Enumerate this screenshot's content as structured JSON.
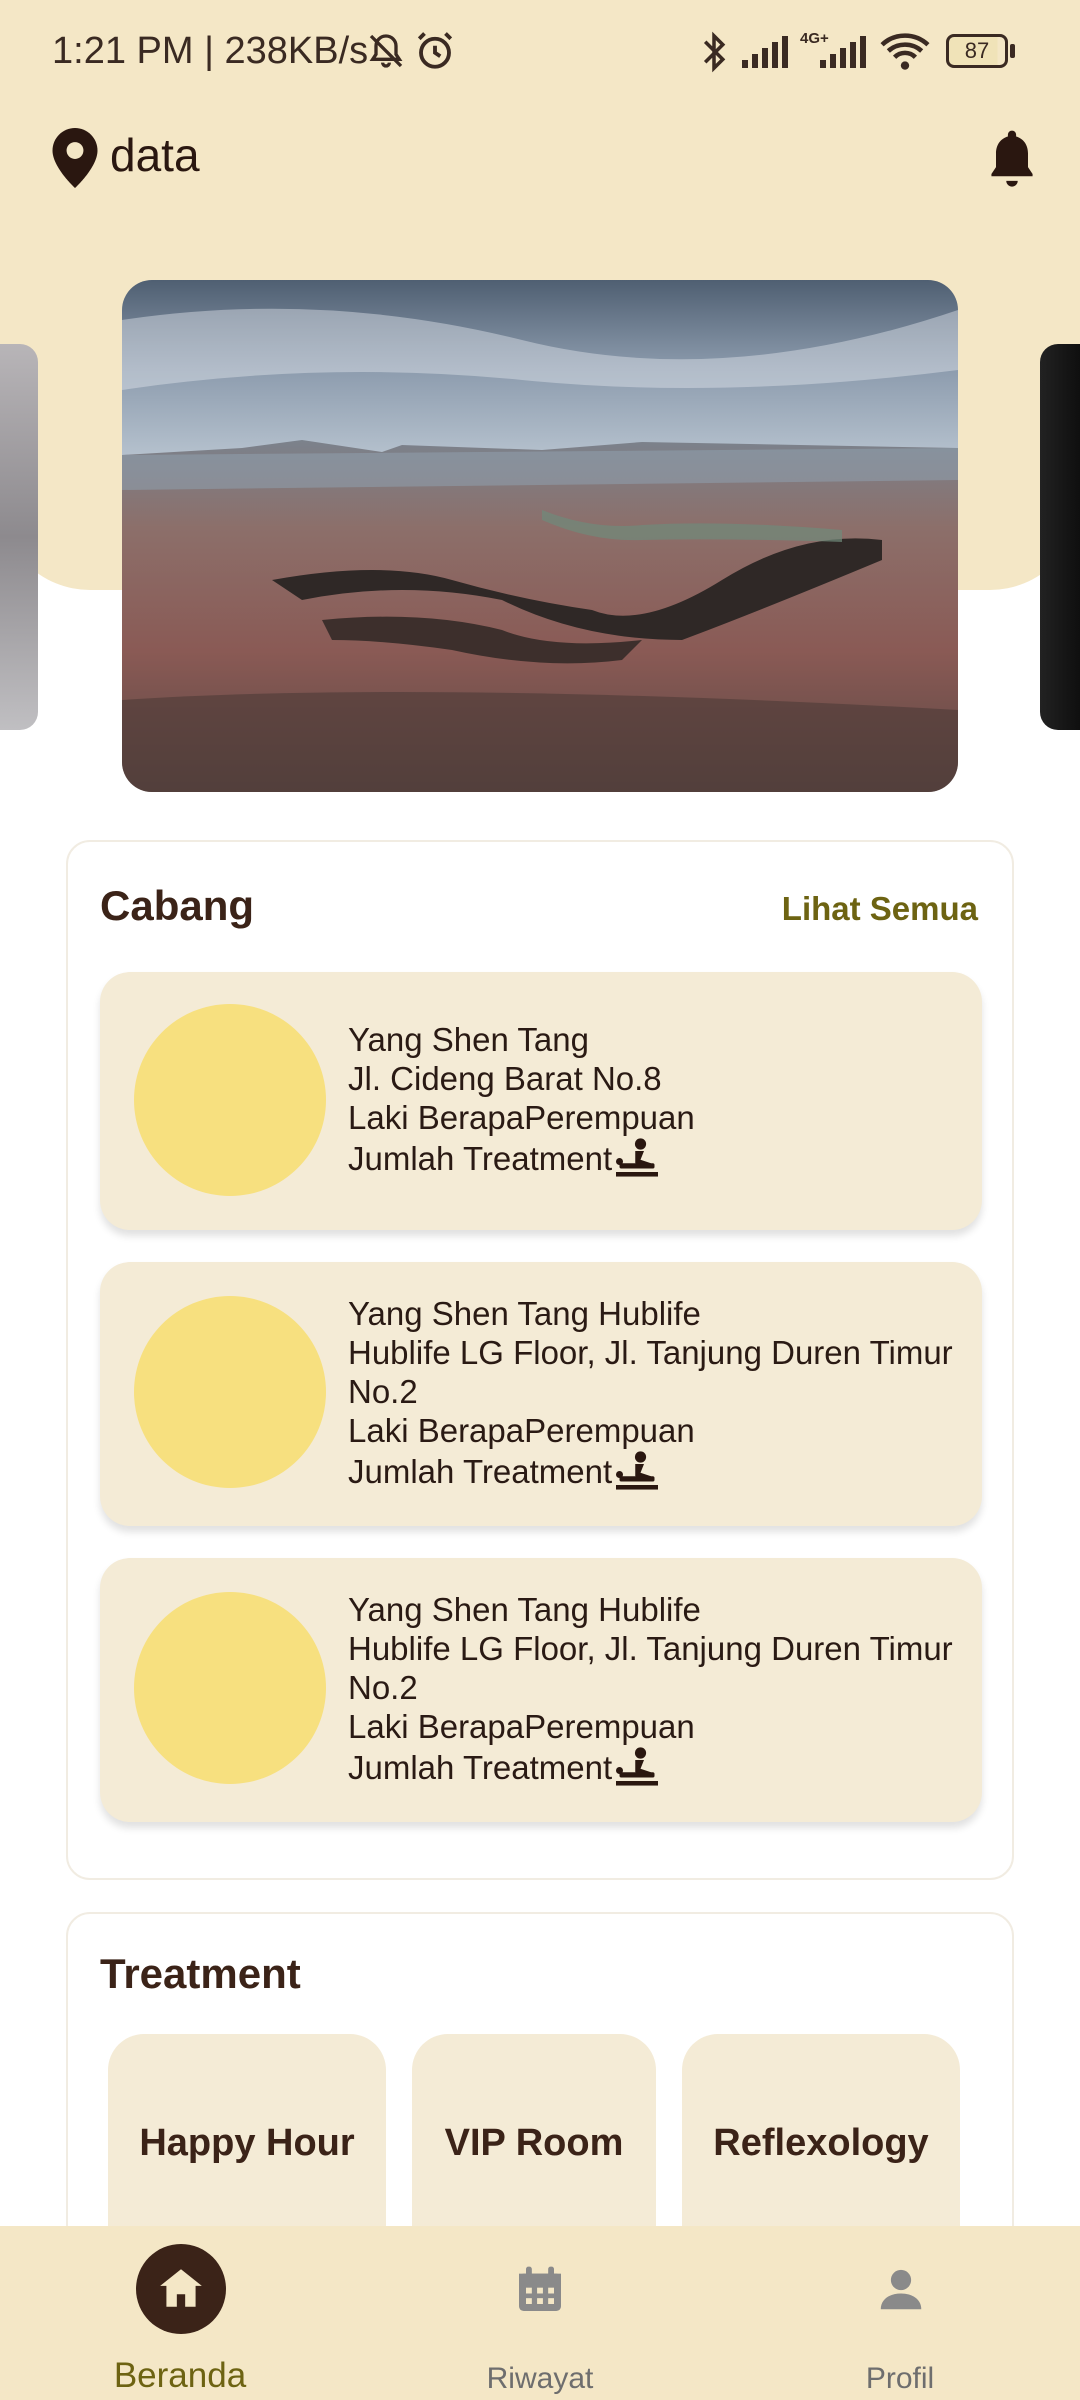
{
  "status_bar": {
    "time_speed": "1:21 PM | 238KB/s",
    "network_label": "4G+",
    "battery": "87"
  },
  "header": {
    "location": "data"
  },
  "branches": {
    "title": "Cabang",
    "see_all": "Lihat Semua",
    "items": [
      {
        "name": "Yang Shen Tang",
        "address": "Jl. Cideng Barat No.8",
        "gender": "Laki BerapaPerempuan",
        "treatment": "Jumlah Treatment"
      },
      {
        "name": "Yang Shen Tang Hublife",
        "address": "Hublife LG Floor, Jl. Tanjung Duren Timur No.2",
        "gender": "Laki BerapaPerempuan",
        "treatment": "Jumlah Treatment"
      },
      {
        "name": "Yang Shen Tang Hublife",
        "address": "Hublife LG Floor, Jl. Tanjung Duren Timur No.2",
        "gender": "Laki BerapaPerempuan",
        "treatment": "Jumlah Treatment"
      }
    ]
  },
  "treatments": {
    "title": "Treatment",
    "items": [
      "Happy Hour",
      "VIP Room",
      "Reflexology"
    ]
  },
  "nav": {
    "items": [
      {
        "label": "Beranda",
        "icon": "home-icon",
        "active": true
      },
      {
        "label": "Riwayat",
        "icon": "calendar-icon",
        "active": false
      },
      {
        "label": "Profil",
        "icon": "person-icon",
        "active": false
      }
    ]
  },
  "colors": {
    "accent": "#3b2318",
    "header_bg": "#f4e7c6",
    "card_bg": "#f4ebd6",
    "avatar": "#f7e07f",
    "link": "#6d6312"
  }
}
